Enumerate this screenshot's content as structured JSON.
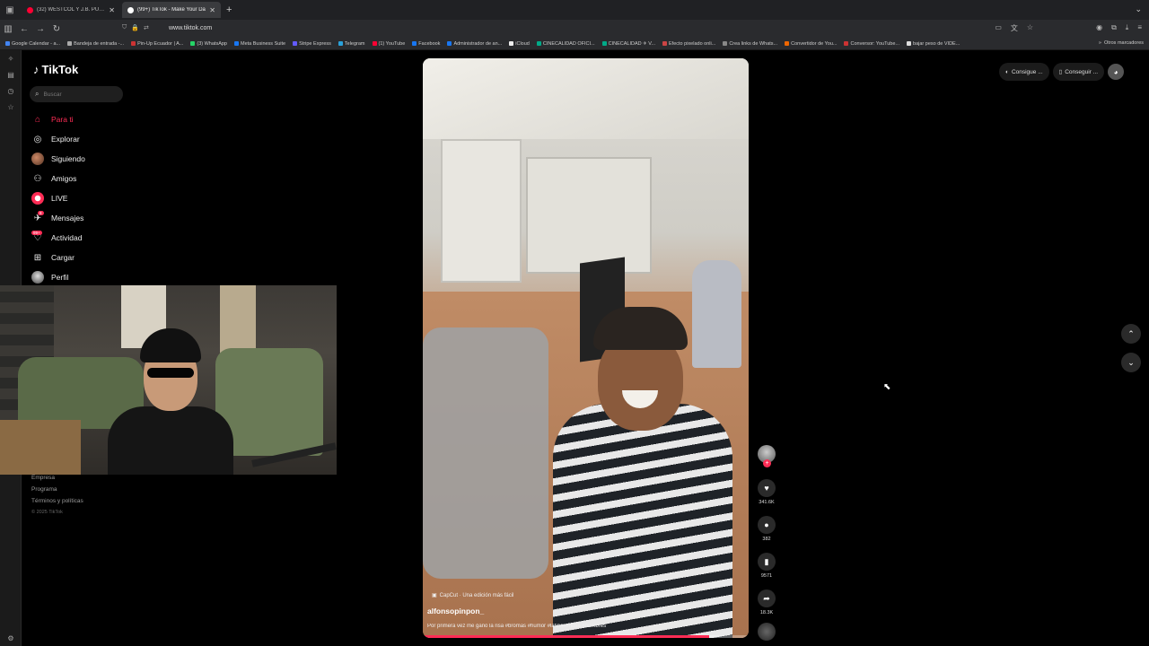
{
  "browser": {
    "tabs": [
      {
        "title": "(32) WESTCOL Y J.B. PUMP REAC",
        "color": "#ff0033",
        "active": false
      },
      {
        "title": "(99+) TikTok - Make Your Da",
        "color": "#ffffff",
        "active": true
      }
    ],
    "new_tab": "+",
    "url": "www.tiktok.com",
    "bookmarks": [
      "Google Calendar - a...",
      "Bandeja de entrada -...",
      "Pin-Up Ecuador | A...",
      "(3) WhatsApp",
      "Meta Business Suite",
      "Stripe Express",
      "Telegram",
      "(1) YouTube",
      "Facebook",
      "Administrador de an...",
      "iCloud",
      "CINECALIDAD OFICI...",
      "CINECALIDAD ✈ V...",
      "Efecto pixelado onli...",
      "Crea links de Whats...",
      "Convertidor de You...",
      "Conversor: YouTube...",
      "bajar peso de VIDE..."
    ],
    "other_bookmarks": "Otros marcadores"
  },
  "tiktok": {
    "logo": "TikTok",
    "search_placeholder": "Buscar",
    "menu": [
      {
        "label": "Para ti",
        "icon": "home-icon",
        "active": true
      },
      {
        "label": "Explorar",
        "icon": "compass-icon",
        "active": false
      },
      {
        "label": "Siguiendo",
        "icon": "following-icon",
        "active": false
      },
      {
        "label": "Amigos",
        "icon": "friends-icon",
        "active": false
      },
      {
        "label": "LIVE",
        "icon": "live-icon",
        "active": false
      },
      {
        "label": "Mensajes",
        "icon": "messages-icon",
        "active": false,
        "badge": "8"
      },
      {
        "label": "Actividad",
        "icon": "activity-icon",
        "active": false,
        "badge": "99+"
      },
      {
        "label": "Cargar",
        "icon": "upload-icon",
        "active": false
      },
      {
        "label": "Perfil",
        "icon": "profile-icon",
        "active": false
      }
    ],
    "footer": {
      "empresa": "Empresa",
      "programa": "Programa",
      "terminos": "Términos y políticas",
      "copyright": "© 2025 TikTok"
    },
    "video": {
      "capcut": "CapCut · Una edición más fácil",
      "username": "alfonsopinpon_",
      "caption": "Por primera vez me gano la risa #bromas #humor #latinosenusa #hombres",
      "progress": 0.88
    },
    "actions": {
      "likes": "341.6K",
      "comments": "382",
      "saves": "9571",
      "shares": "18.3K"
    },
    "top_right": {
      "pill1": "Consigue ...",
      "pill2": "Conseguir ..."
    }
  },
  "colors": {
    "accent": "#fe2c55",
    "background": "#000000"
  }
}
